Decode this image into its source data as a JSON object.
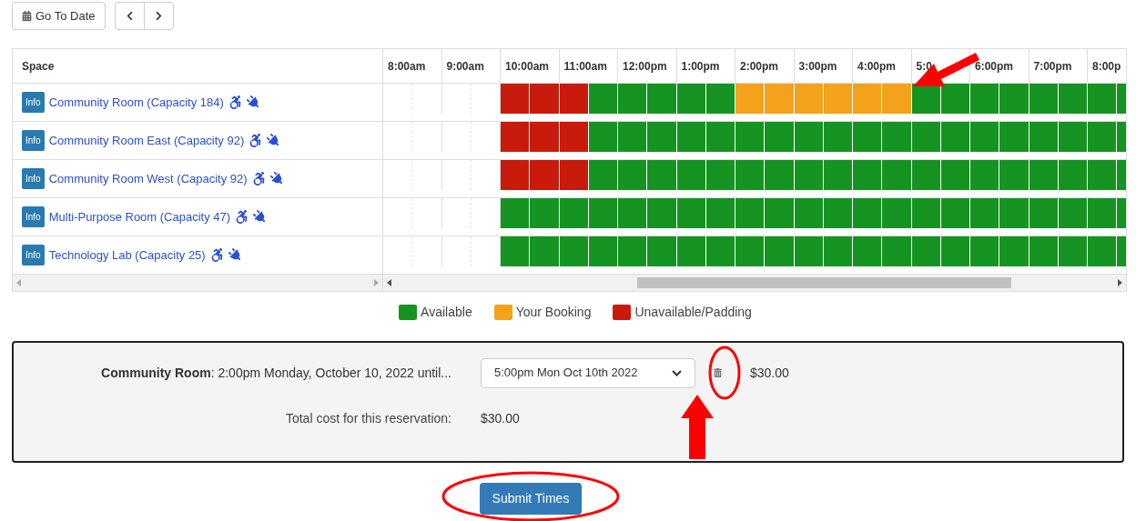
{
  "toolbar": {
    "go_to_date": "Go To Date"
  },
  "table": {
    "space_header": "Space",
    "hours": [
      "8:00am",
      "9:00am",
      "10:00am",
      "11:00am",
      "12:00pm",
      "1:00pm",
      "2:00pm",
      "3:00pm",
      "4:00pm",
      "5:0",
      "6:00pm",
      "7:00pm",
      "8:00p"
    ],
    "rows": [
      {
        "info": "Info",
        "name": "Community Room (Capacity 184)",
        "slots": [
          {
            "kind": "empty"
          },
          {
            "kind": "empty"
          },
          {
            "kind": "empty"
          },
          {
            "kind": "empty"
          },
          {
            "kind": "unavailable"
          },
          {
            "kind": "unavailable"
          },
          {
            "kind": "unavailable"
          },
          {
            "kind": "available"
          },
          {
            "kind": "available"
          },
          {
            "kind": "available"
          },
          {
            "kind": "available"
          },
          {
            "kind": "available"
          },
          {
            "kind": "booking"
          },
          {
            "kind": "booking"
          },
          {
            "kind": "booking"
          },
          {
            "kind": "booking"
          },
          {
            "kind": "booking"
          },
          {
            "kind": "booking"
          },
          {
            "kind": "available"
          },
          {
            "kind": "available"
          },
          {
            "kind": "available"
          },
          {
            "kind": "available"
          },
          {
            "kind": "available"
          },
          {
            "kind": "available"
          },
          {
            "kind": "available"
          },
          {
            "kind": "available"
          }
        ]
      },
      {
        "info": "Info",
        "name": "Community Room East (Capacity 92)",
        "slots": [
          {
            "kind": "empty"
          },
          {
            "kind": "empty"
          },
          {
            "kind": "empty"
          },
          {
            "kind": "empty"
          },
          {
            "kind": "unavailable"
          },
          {
            "kind": "unavailable"
          },
          {
            "kind": "unavailable"
          },
          {
            "kind": "available"
          },
          {
            "kind": "available"
          },
          {
            "kind": "available"
          },
          {
            "kind": "available"
          },
          {
            "kind": "available"
          },
          {
            "kind": "available"
          },
          {
            "kind": "available"
          },
          {
            "kind": "available"
          },
          {
            "kind": "available"
          },
          {
            "kind": "available"
          },
          {
            "kind": "available"
          },
          {
            "kind": "available"
          },
          {
            "kind": "available"
          },
          {
            "kind": "available"
          },
          {
            "kind": "available"
          },
          {
            "kind": "available"
          },
          {
            "kind": "available"
          },
          {
            "kind": "available"
          },
          {
            "kind": "available"
          }
        ]
      },
      {
        "info": "Info",
        "name": "Community Room West (Capacity 92)",
        "slots": [
          {
            "kind": "empty"
          },
          {
            "kind": "empty"
          },
          {
            "kind": "empty"
          },
          {
            "kind": "empty"
          },
          {
            "kind": "unavailable"
          },
          {
            "kind": "unavailable"
          },
          {
            "kind": "unavailable"
          },
          {
            "kind": "available"
          },
          {
            "kind": "available"
          },
          {
            "kind": "available"
          },
          {
            "kind": "available"
          },
          {
            "kind": "available"
          },
          {
            "kind": "available"
          },
          {
            "kind": "available"
          },
          {
            "kind": "available"
          },
          {
            "kind": "available"
          },
          {
            "kind": "available"
          },
          {
            "kind": "available"
          },
          {
            "kind": "available"
          },
          {
            "kind": "available"
          },
          {
            "kind": "available"
          },
          {
            "kind": "available"
          },
          {
            "kind": "available"
          },
          {
            "kind": "available"
          },
          {
            "kind": "available"
          },
          {
            "kind": "available"
          }
        ]
      },
      {
        "info": "Info",
        "name": "Multi-Purpose Room (Capacity 47)",
        "slots": [
          {
            "kind": "empty"
          },
          {
            "kind": "empty"
          },
          {
            "kind": "empty"
          },
          {
            "kind": "empty"
          },
          {
            "kind": "available"
          },
          {
            "kind": "available"
          },
          {
            "kind": "available"
          },
          {
            "kind": "available"
          },
          {
            "kind": "available"
          },
          {
            "kind": "available"
          },
          {
            "kind": "available"
          },
          {
            "kind": "available"
          },
          {
            "kind": "available"
          },
          {
            "kind": "available"
          },
          {
            "kind": "available"
          },
          {
            "kind": "available"
          },
          {
            "kind": "available"
          },
          {
            "kind": "available"
          },
          {
            "kind": "available"
          },
          {
            "kind": "available"
          },
          {
            "kind": "available"
          },
          {
            "kind": "available"
          },
          {
            "kind": "available"
          },
          {
            "kind": "available"
          },
          {
            "kind": "available"
          },
          {
            "kind": "available"
          }
        ]
      },
      {
        "info": "Info",
        "name": "Technology Lab (Capacity 25)",
        "slots": [
          {
            "kind": "empty"
          },
          {
            "kind": "empty"
          },
          {
            "kind": "empty"
          },
          {
            "kind": "empty"
          },
          {
            "kind": "available"
          },
          {
            "kind": "available"
          },
          {
            "kind": "available"
          },
          {
            "kind": "available"
          },
          {
            "kind": "available"
          },
          {
            "kind": "available"
          },
          {
            "kind": "available"
          },
          {
            "kind": "available"
          },
          {
            "kind": "available"
          },
          {
            "kind": "available"
          },
          {
            "kind": "available"
          },
          {
            "kind": "available"
          },
          {
            "kind": "available"
          },
          {
            "kind": "available"
          },
          {
            "kind": "available"
          },
          {
            "kind": "available"
          },
          {
            "kind": "available"
          },
          {
            "kind": "available"
          },
          {
            "kind": "available"
          },
          {
            "kind": "available"
          },
          {
            "kind": "available"
          },
          {
            "kind": "available"
          }
        ]
      }
    ]
  },
  "legend": [
    {
      "kind": "available",
      "label": "Available",
      "color": "#169422"
    },
    {
      "kind": "booking",
      "label": "Your Booking",
      "color": "#f4a11b"
    },
    {
      "kind": "unavailable",
      "label": "Unavailable/Padding",
      "color": "#c81b0c"
    }
  ],
  "reservation": {
    "summary": "**Community Room**: 2:00pm Monday, October 10, 2022 until...",
    "end_time": "5:00pm Mon Oct 10th 2022",
    "price": "$30.00",
    "total_label": "Total cost for this reservation:",
    "total": "$30.00"
  },
  "submit": "Submit Times"
}
